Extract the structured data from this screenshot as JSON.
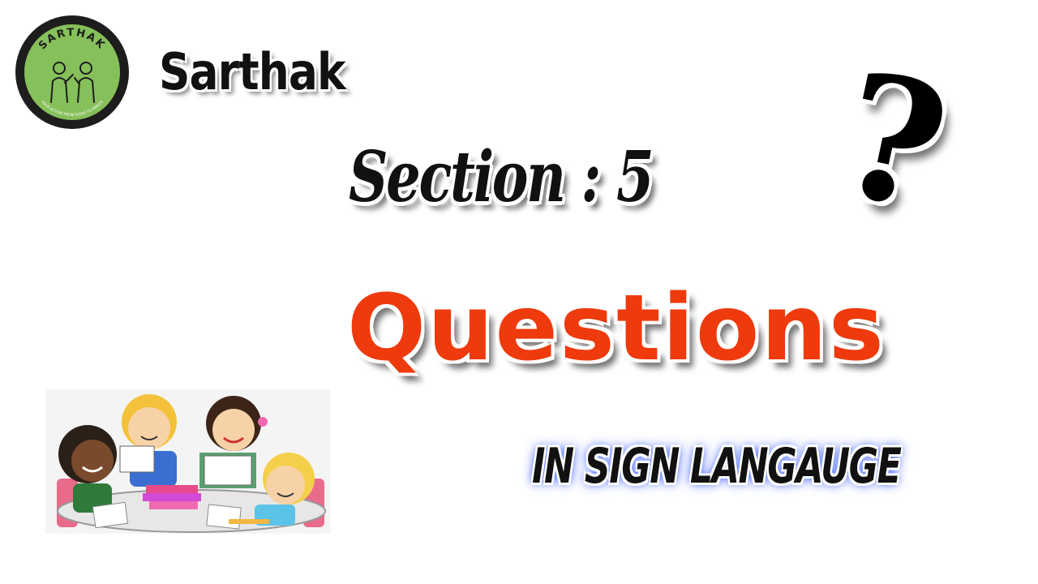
{
  "brand": {
    "name": "Sarthak",
    "logo_text": "SARTHAK",
    "logo_tagline": "YOUR ACTION FROM SIGNS TO SMILES",
    "logo_color": "#86c05a"
  },
  "headline": {
    "section": "Section :  5",
    "questions": "Questions",
    "subtitle": "IN SIGN LANGAUGE",
    "questions_color": "#ee3a0c",
    "glow_color": "#3a5bff"
  },
  "decor": {
    "question_mark": "?",
    "illustration": "children-studying-illustration"
  }
}
